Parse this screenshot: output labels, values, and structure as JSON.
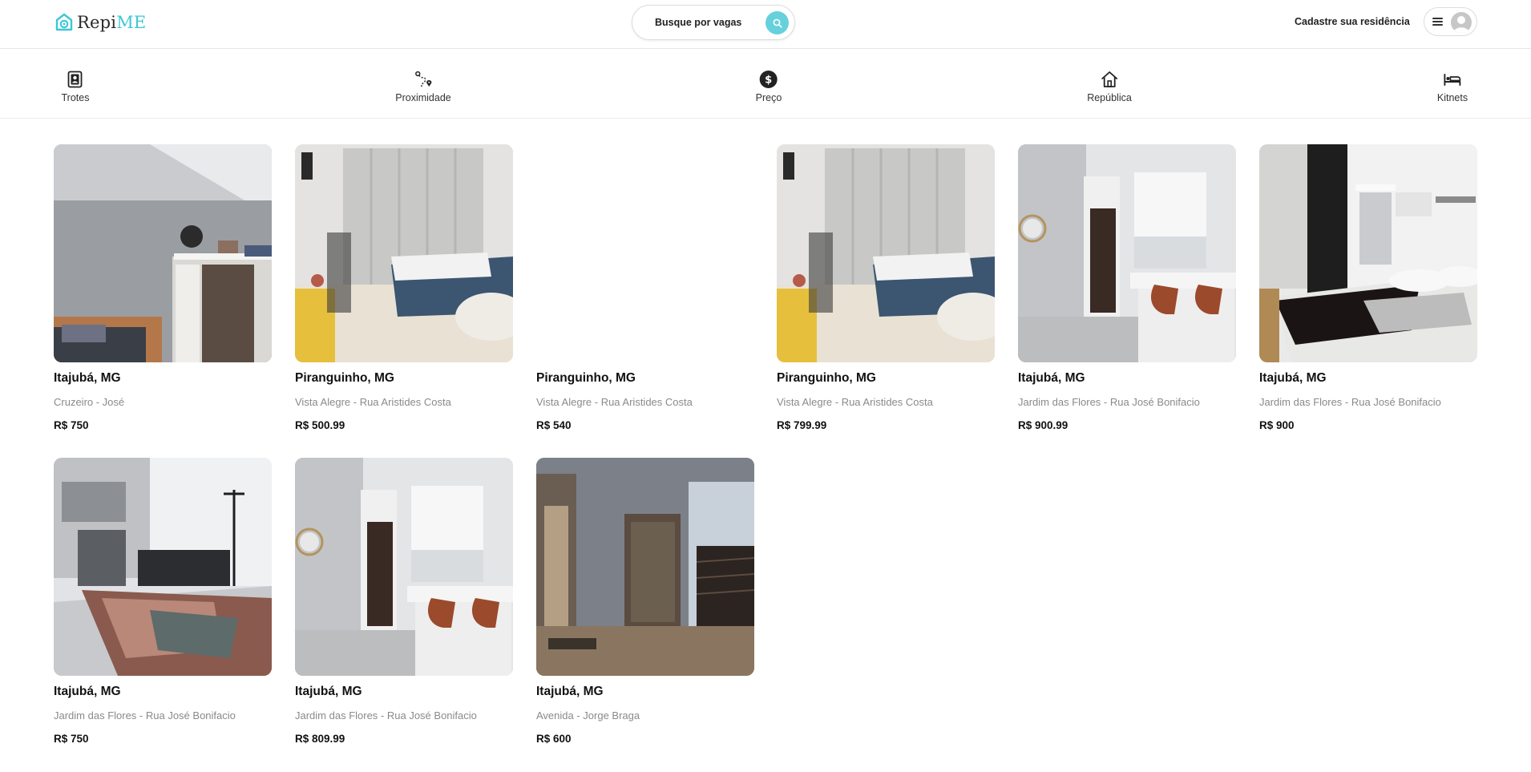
{
  "brand": {
    "name_primary": "Repi",
    "name_accent": "ME",
    "accent_color": "#3ec7d6"
  },
  "header": {
    "search_label": "Busque por vagas",
    "search_icon": "search-icon",
    "cadastre_label": "Cadastre sua residência",
    "menu_icon": "hamburger-icon",
    "avatar_icon": "user-avatar-icon"
  },
  "categories": [
    {
      "label": "Trotes",
      "icon": "photo-frame-icon"
    },
    {
      "label": "Proximidade",
      "icon": "route-pin-icon"
    },
    {
      "label": "Preço",
      "icon": "dollar-circle-icon"
    },
    {
      "label": "República",
      "icon": "house-icon"
    },
    {
      "label": "Kitnets",
      "icon": "bed-icon"
    }
  ],
  "listings": [
    {
      "city": "Itajubá, MG",
      "address": "Cruzeiro - José",
      "price": "R$ 750",
      "image": "room-wardrobe"
    },
    {
      "city": "Piranguinho, MG",
      "address": "Vista Alegre - Rua Aristides Costa",
      "price": "R$ 500.99",
      "image": "room-curtains-bed"
    },
    {
      "city": "Piranguinho, MG",
      "address": "Vista Alegre - Rua Aristides Costa",
      "price": "R$ 540",
      "image": "none"
    },
    {
      "city": "Piranguinho, MG",
      "address": "Vista Alegre - Rua Aristides Costa",
      "price": "R$ 799.99",
      "image": "room-curtains-bed"
    },
    {
      "city": "Itajubá, MG",
      "address": "Jardim das Flores - Rua José Bonifacio",
      "price": "R$ 900.99",
      "image": "kitchen-stools"
    },
    {
      "city": "Itajubá, MG",
      "address": "Jardim das Flores - Rua José Bonifacio",
      "price": "R$ 900",
      "image": "bedroom-dark-wall"
    },
    {
      "city": "Itajubá, MG",
      "address": "Jardim das Flores - Rua José Bonifacio",
      "price": "R$ 750",
      "image": "room-patchwork-sofa"
    },
    {
      "city": "Itajubá, MG",
      "address": "Jardim das Flores - Rua José Bonifacio",
      "price": "R$ 809.99",
      "image": "kitchen-stools"
    },
    {
      "city": "Itajubá, MG",
      "address": "Avenida - Jorge Braga",
      "price": "R$ 600",
      "image": "hallway-stairs"
    }
  ]
}
